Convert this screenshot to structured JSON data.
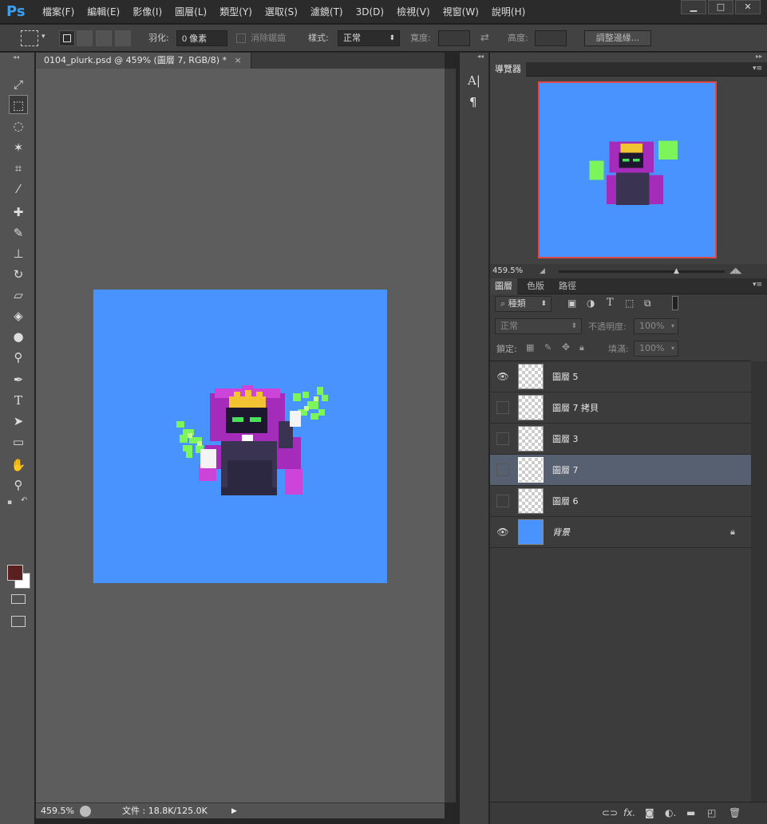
{
  "app": {
    "logo": "Ps"
  },
  "menu": [
    "檔案(F)",
    "編輯(E)",
    "影像(I)",
    "圖層(L)",
    "類型(Y)",
    "選取(S)",
    "濾鏡(T)",
    "3D(D)",
    "檢視(V)",
    "視窗(W)",
    "說明(H)"
  ],
  "window_controls": {
    "minimize": "▁",
    "maximize": "□",
    "close": "✕"
  },
  "options": {
    "feather_label": "羽化:",
    "feather_value": "0 像素",
    "antialias_label": "消除鋸齒",
    "style_label": "樣式:",
    "style_value": "正常",
    "width_label": "寬度:",
    "height_label": "高度:",
    "refine_button": "調整邊緣..."
  },
  "document": {
    "tab_title": "0104_plurk.psd @ 459% (圖層 7, RGB/8) *",
    "tab_close": "×",
    "canvas_color": "#4893fe"
  },
  "status": {
    "zoom": "459.5%",
    "doc_info": "文件 : 18.8K/125.0K"
  },
  "navigator": {
    "tab": "導覽器",
    "zoom": "459.5%"
  },
  "layers_panel": {
    "tabs": [
      "圖層",
      "色版",
      "路徑"
    ],
    "filter_kind": "種類",
    "blend_mode": "正常",
    "opacity_label": "不透明度:",
    "opacity_value": "100%",
    "lock_label": "鎖定:",
    "fill_label": "填滿:",
    "fill_value": "100%",
    "layers": [
      {
        "name": "圖層 5",
        "visible": true,
        "selected": false
      },
      {
        "name": "圖層 7 拷貝",
        "visible": false,
        "selected": false
      },
      {
        "name": "圖層 3",
        "visible": false,
        "selected": false
      },
      {
        "name": "圖層 7",
        "visible": false,
        "selected": true
      },
      {
        "name": "圖層 6",
        "visible": false,
        "selected": false
      },
      {
        "name": "背景",
        "visible": true,
        "selected": false,
        "locked": true
      }
    ]
  },
  "strip": {
    "char_icon": "A|",
    "para_icon": "¶"
  },
  "colors": {
    "foreground": "#5a1f1f",
    "background": "#ffffff",
    "accent": "#3aa1f2"
  }
}
